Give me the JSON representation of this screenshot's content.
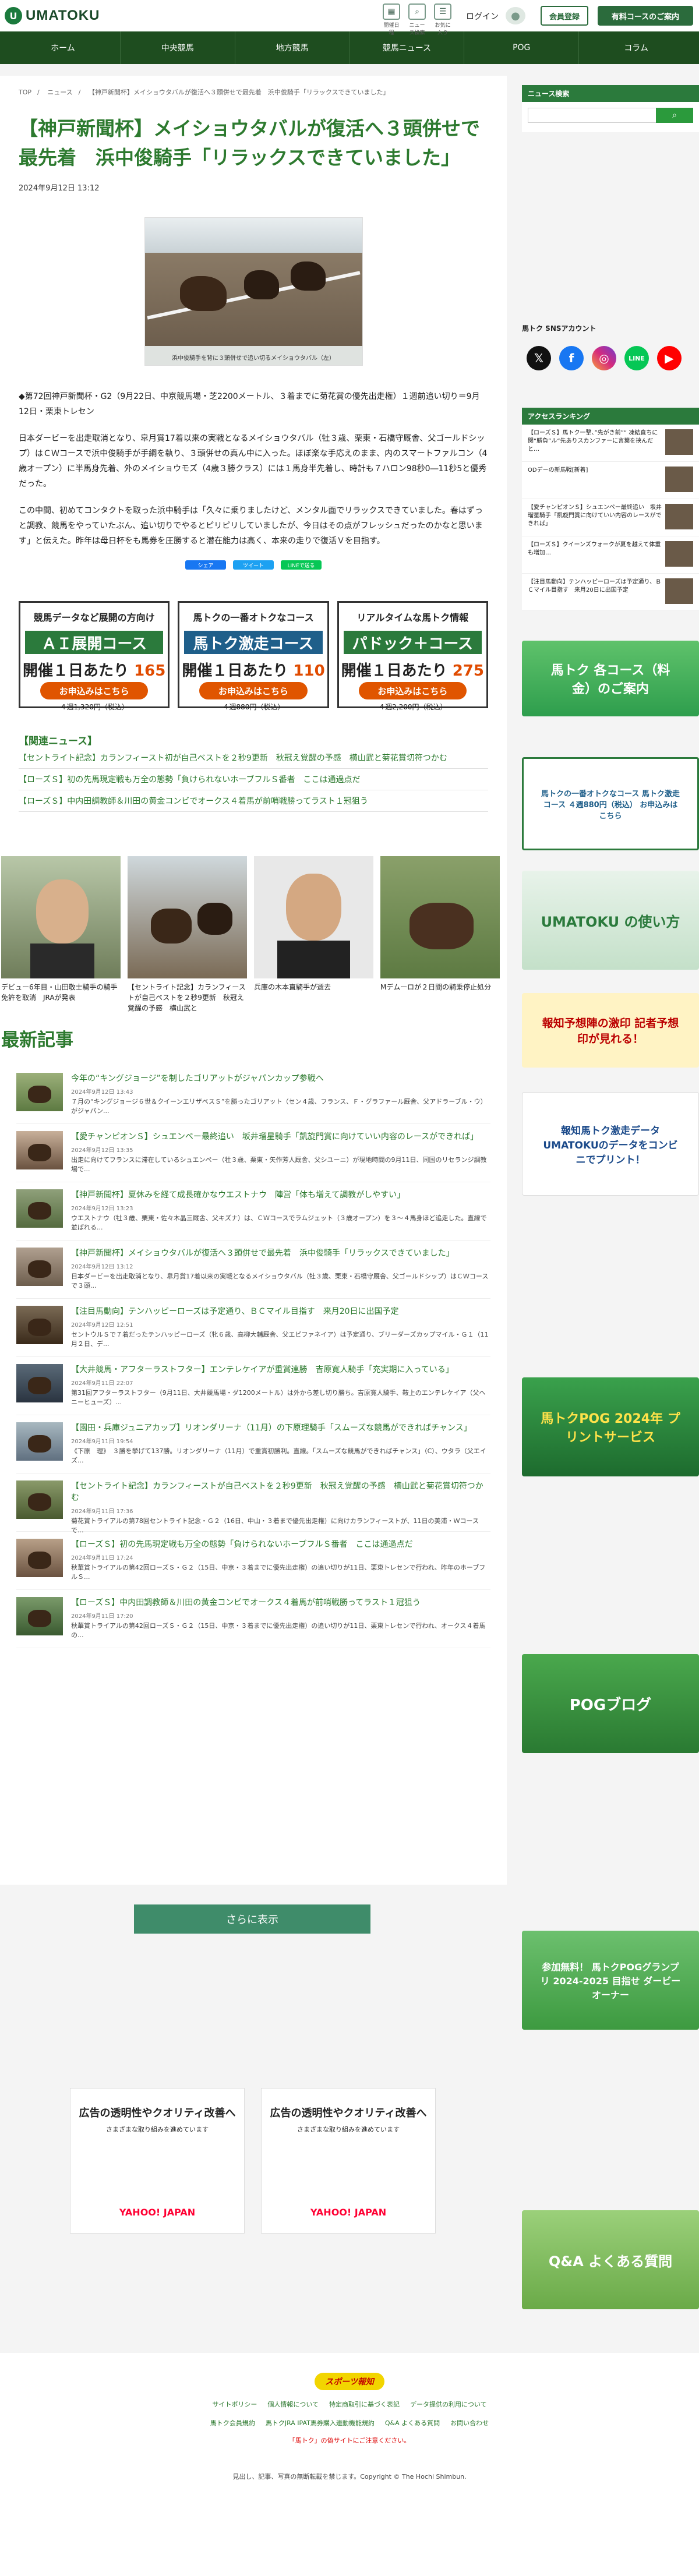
{
  "header": {
    "logo_text": "UMATOKU",
    "icons": [
      {
        "name": "calendar-icon",
        "label": "開催日程"
      },
      {
        "name": "search-icon",
        "label": "ニュース検索"
      },
      {
        "name": "bookmark-icon",
        "label": "お気に入り"
      }
    ],
    "login": "ログイン",
    "register": "会員登録",
    "paid_course": "有料コースのご案内"
  },
  "nav": [
    "ホーム",
    "中央競馬",
    "地方競馬",
    "競馬ニュース",
    "POG",
    "コラム"
  ],
  "breadcrumb": [
    "TOP",
    "ニュース",
    "【神戸新聞杯】メイショウタバルが復活へ３頭併せで最先着　浜中俊騎手「リラックスできていました」"
  ],
  "article": {
    "title": "【神戸新聞杯】メイショウタバルが復活へ３頭併せで最先着　浜中俊騎手「リラックスできていました」",
    "date": "2024年9月12日 13:12",
    "photo_caption": "浜中俊騎手を背に３頭併せで追い切るメイショウタバル（左）",
    "paragraphs": [
      "◆第72回神戸新聞杯・G2（9月22日、中京競馬場・芝2200メートル、３着までに菊花賞の優先出走権）１週前追い切り＝9月12日・栗東トレセン",
      "日本ダービーを出走取消となり、皐月賞17着以来の実戦となるメイショウタバル（牡３歳、栗東・石橋守厩舎、父ゴールドシップ）はＣＷコースで浜中俊騎手が手綱を執り、３頭併せの真ん中に入った。ほぼ楽な手応えのまま、内のスマートファルコン（4歳オープン）に半馬身先着、外のメイショウモズ（4歳３勝クラス）には１馬身半先着し、時計も７ハロン98秒0―11秒5と優秀だった。",
      "この中間、初めてコンタクトを取った浜中騎手は「久々に乗りましたけど、メンタル面でリラックスできていました。春はずっと調教、競馬をやっていたぶん、追い切りでやるとピリピリしていましたが、今日はその点がフレッシュだったのかなと思います」と伝えた。昨年は母日杯をも馬券を圧勝すると潜在能力は高く、本来の走りで復活Ｖを目指す。"
    ],
    "share": [
      "シェア",
      "ツイート",
      "LINEで送る"
    ]
  },
  "promo": [
    {
      "top": "競馬データなど展開の方向け",
      "band": "ＡＩ展開コース",
      "price_pre": "開催１日あたり",
      "price": "165円",
      "sub": "４週1,320円（税込）",
      "cta": "お申込みはこちら"
    },
    {
      "top": "馬トクの一番オトクなコース",
      "band": "馬トク激走コース",
      "price_pre": "開催１日あたり",
      "price": "110円",
      "sub": "４週880円（税込）",
      "cta": "お申込みはこちら"
    },
    {
      "top": "リアルタイムな馬トク情報",
      "band": "パドック＋コース",
      "price_pre": "開催１日あたり",
      "price": "275円",
      "sub": "４週2,200円（税込）",
      "cta": "お申込みはこちら"
    }
  ],
  "related": {
    "heading": "【関連ニュース】",
    "items": [
      "【セントライト記念】カランフィースト初が自己ベストを２秒9更新　秋冠え覚醒の予感　横山武と菊花賞切符つかむ",
      "【ローズＳ】初の先馬現定戦も万全の態勢「負けられないホーブフルＳ番者　ここは通過点だ",
      "【ローズＳ】中内田調教師＆川田の黄金コンビでオークス４着馬が前哨戦勝ってラスト１冠狙う"
    ]
  },
  "tiles": [
    "デビュー6年目・山田敬士騎手の騎手免許を取消　JRAが発表",
    "【セントライト記念】カランフィーストが自己ベストを２秒9更新　秋冠え覚醒の予感　横山武と",
    "兵庫の木本直騎手が逝去",
    "Mデムーロが２日間の騎乗停止処分"
  ],
  "latest": {
    "heading": "最新記事",
    "items": [
      {
        "title": "今年の“キングジョージ”を制したゴリアットがジャパンカップ参戦へ",
        "date": "2024年9月12日 13:43",
        "snippet": "７月の“キングジョージ６世＆クイーンエリザベスＳ”を勝ったゴリアット（セン４歳、フランス、Ｆ・グラファール厩舎、父アドラーブル・ウ）がジャパン..."
      },
      {
        "title": "【愛チャンピオンＳ】シュエンペー最終追い　坂井瑠星騎手「凱旋門賞に向けていい内容のレースができれば」",
        "date": "2024年9月12日 13:35",
        "snippet": "出走に向けてフランスに滞在しているシュエンペー（牡３歳、栗東・矢作芳人厩舎、父シユーニ）が現地時間の9月11日、同国のリセランジ調教場で..."
      },
      {
        "title": "【神戸新聞杯】夏休みを経て成長確かなウエストナウ　陣営「体も増えて調教がしやすい」",
        "date": "2024年9月12日 13:23",
        "snippet": "ウエストナウ（牡３歳、栗東・佐々木晶三厩舎、父キズナ）は、ＣＷコースでラムジェット（３歳オープン）を３～４馬身ほど追走した。直線で並ばれる..."
      },
      {
        "title": "【神戸新聞杯】メイショウタバルが復活へ３頭併せで最先着　浜中俊騎手「リラックスできていました」",
        "date": "2024年9月12日 13:12",
        "snippet": "日本ダービーを出走取消となり、皐月賞17着以来の実戦となるメイショウタバル（牡３歳、栗東・石橋守厩舎、父ゴールドシップ）はＣＷコースで３頭..."
      },
      {
        "title": "【注目馬動向】テンハッピーローズは予定通り、ＢＣマイル目指す　来月20日に出国予定",
        "date": "2024年9月12日 12:51",
        "snippet": "セントウルＳで７着だったテンハッピーローズ（牝６歳、高柳大輔厩舎、父エピファネイア）は予定通り、ブリーダーズカップマイル・Ｇ１（11月２日、デ..."
      },
      {
        "title": "【大井競馬・アフターラストフター】エンテレケイアが重賞連勝　吉原寛人騎手「充実期に入っている」",
        "date": "2024年9月11日 22:07",
        "snippet": "第31回アフターラストフター（9月11日、大井競馬場・ダ1200メートル）は外から差し切り勝ち。吉原寛人騎手、鞍上のエンテレケイア（父ヘニーヒューズ）..."
      },
      {
        "title": "【園田・兵庫ジュニアカップ】リオンダリーナ（11月）の下原理騎手「スムーズな競馬ができればチャンス」",
        "date": "2024年9月11日 19:54",
        "snippet": "《下原　理》　３勝を挙げて137勝。リオンダリーナ（11月）で重賞初勝利。直線。「スムーズな競馬ができればチャンス」（C）、ウタラ（父エイズ..."
      },
      {
        "title": "【セントライト記念】カランフィーストが自己ベストを２秒9更新　秋冠え覚醒の予感　横山武と菊花賞切符つかむ",
        "date": "2024年9月11日 17:36",
        "snippet": "菊花賞トライアルの第78回セントライト記念・Ｇ２（16日、中山・３着まで優先出走権）に向けカランフィーストが、11日の美浦・Ｗコースで..."
      },
      {
        "title": "【ローズＳ】初の先馬現定戦も万全の態勢「負けられないホーブフルＳ番者　ここは通過点だ",
        "date": "2024年9月11日 17:24",
        "snippet": "秋華賞トライアルの第42回ローズＳ・Ｇ２（15日、中京・３着までに優先出走権）の追い切りが11日、栗東トレセンで行われ、昨年のホーブフルＳ..."
      },
      {
        "title": "【ローズＳ】中内田調教師＆川田の黄金コンビでオークス４着馬が前哨戦勝ってラスト１冠狙う",
        "date": "2024年9月11日 17:20",
        "snippet": "秋華賞トライアルの第42回ローズＳ・Ｇ２（15日、中京・３着までに優先出走権）の追い切りが11日、栗東トレセンで行われ、オークス４着馬の..."
      }
    ],
    "more": "さらに表示"
  },
  "sidebar": {
    "news_search": "ニュース検索",
    "sns_heading": "馬トク SNSアカウント",
    "access_heading": "アクセスランキング",
    "access_items": [
      "【ローズＳ】馬トク一撃、”先がき前”“ 凍結直ちに関“勝負”ル“先ありスカンファーに言葉を挟んだと…",
      "ODデーの新馬戦[新着]",
      "【愛チャンピオンＳ】シュエンペー最終追い　坂井瑠星騎手「凱旋門賞に向けていい内容のレースができれば」",
      "【ローズＳ】クイーンズウォークが夏を越えて体重も増加…",
      "【注目馬動向】テンハッピーローズは予定通り、ＢＣマイル目指す　来月20日に出国予定"
    ],
    "banners": [
      "馬トク 各コース（料金）のご案内",
      "馬トクの一番オトクなコース 馬トク激走コース ４週880円（税込） お申込みはこちら",
      "UMATOKU の使い方",
      "報知予想陣の激印 記者予想印が見れる！",
      "報知馬トク激走データ UMATOKUのデータをコンビニでプリント！",
      "馬トクPOG 2024年 プリントサービス",
      "POGブログ",
      "参加無料！ 馬トクPOGグランプリ 2024-2025 目指せ ダービーオーナー",
      "Q&A よくある質問"
    ]
  },
  "ads": [
    "広告の透明性やクオリティ改善へ",
    "広告の透明性やクオリティ改善へ"
  ],
  "ads_sub": "さまざまな取り組みを進めています",
  "ads_brand": "YAHOO! JAPAN",
  "footer": {
    "logo": "スポーツ報知",
    "row1": [
      "サイトポリシー",
      "個人情報について",
      "特定商取引に基づく表記",
      "データ提供の利用について"
    ],
    "row2": [
      "馬トク会員規約",
      "馬トクJRA IPAT馬券購入連動機能規約",
      "Q&A よくある質問",
      "お問い合わせ"
    ],
    "red": "「馬トク」の偽サイトにご注意ください。",
    "copyright": "見出し、記事、写真の無断転載を禁じます。Copyright © The Hochi Shimbun."
  },
  "colors": {
    "brand_green": "#2b7a3c",
    "title_green": "#2d7a2f",
    "nav_bg": "#1e4d1f",
    "accent_orange": "#e05500"
  }
}
